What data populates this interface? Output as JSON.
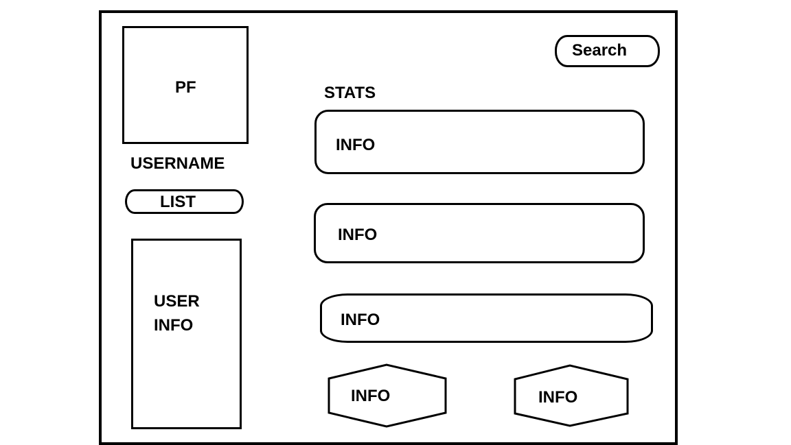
{
  "profile": {
    "picture_label": "PF",
    "username": "USERNAME",
    "list_button": "LIST",
    "user_info_line1": "USER",
    "user_info_line2": "INFO"
  },
  "header": {
    "search_button": "Search"
  },
  "stats": {
    "title": "STATS",
    "cards": [
      {
        "label": "INFO"
      },
      {
        "label": "INFO"
      },
      {
        "label": "INFO"
      }
    ],
    "hex_items": [
      {
        "label": "INFO"
      },
      {
        "label": "INFO"
      }
    ]
  }
}
